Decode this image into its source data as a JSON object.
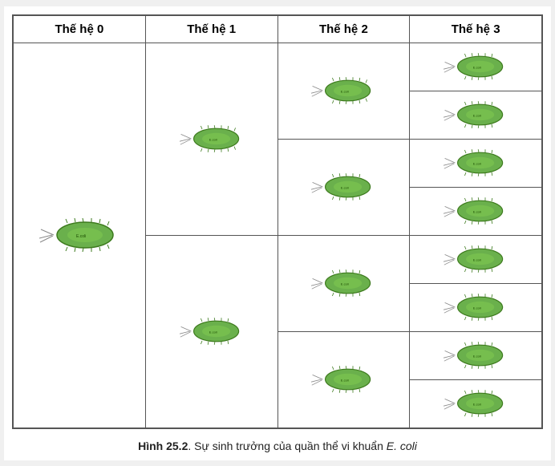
{
  "headers": {
    "gen0": "Thế hệ 0",
    "gen1": "Thế hệ 1",
    "gen2": "Thế hệ 2",
    "gen3": "Thế hệ 3"
  },
  "caption": {
    "prefix": "Hình 25.2",
    "text": ". Sự sinh trưởng của quần thể vi khuẩn ",
    "species": "E. coli"
  }
}
